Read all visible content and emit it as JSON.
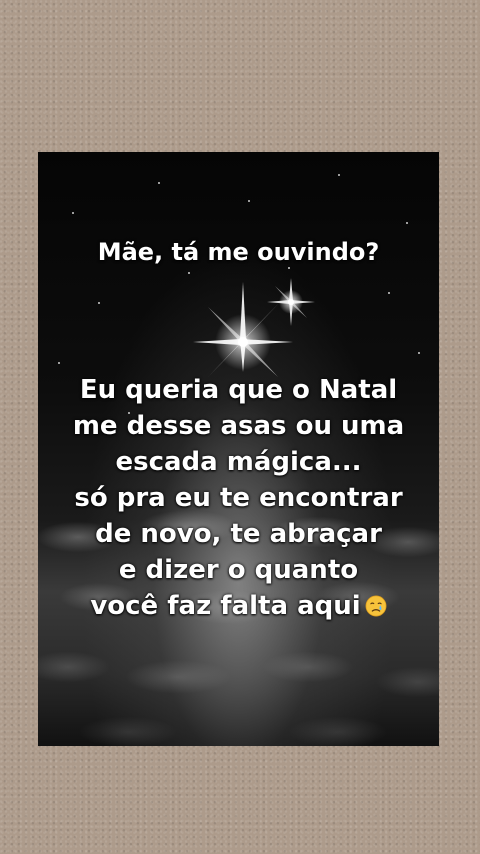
{
  "post": {
    "headline": "Mãe, tá me ouvindo?",
    "message_lines": [
      "Eu queria que o Natal",
      "me desse asas ou uma",
      "escada mágica...",
      "só pra eu te encontrar",
      "de novo, te abraçar",
      "e dizer o quanto",
      "você faz falta aqui"
    ],
    "emoji": "crying-face",
    "colors": {
      "page_background": "#ad9b8b",
      "text": "#ffffff",
      "sky": "#050505"
    }
  }
}
